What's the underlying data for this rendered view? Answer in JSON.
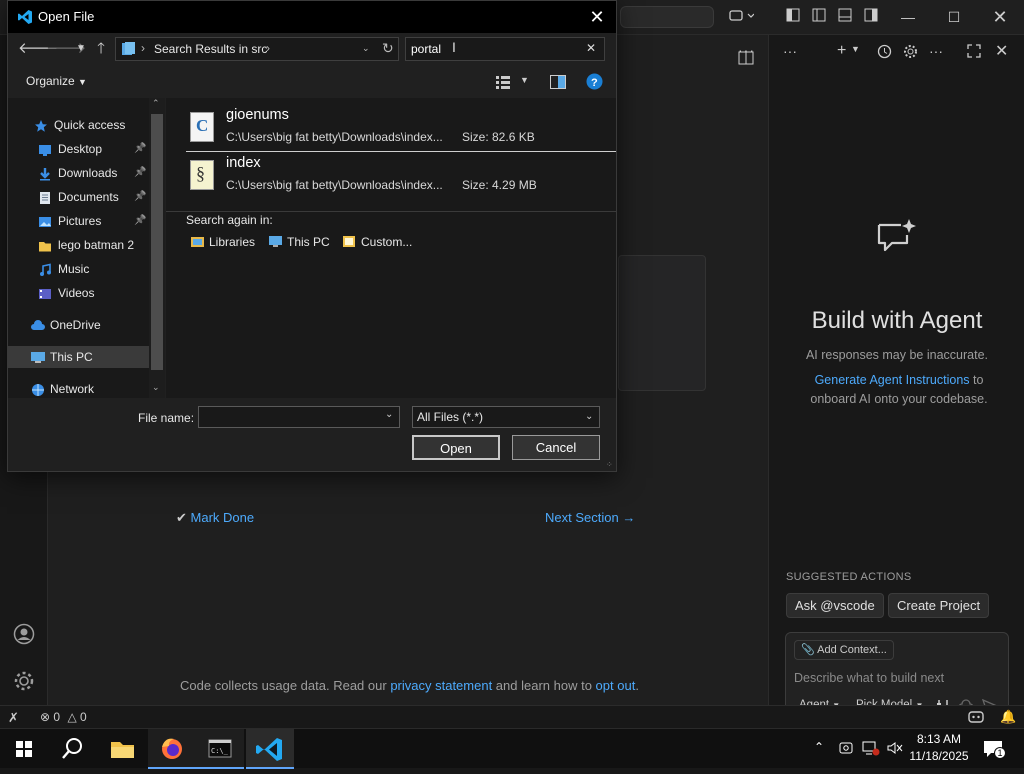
{
  "dialog": {
    "title": "Open File",
    "address": {
      "location": "Search Results in src"
    },
    "search": {
      "value": "portal"
    },
    "toolbar": {
      "organize_label": "Organize"
    },
    "nav": [
      {
        "label": "Quick access",
        "icon": "star-icon",
        "pinned": false
      },
      {
        "label": "Desktop",
        "icon": "desktop-folder-icon",
        "pinned": true
      },
      {
        "label": "Downloads",
        "icon": "download-arrow-icon",
        "pinned": true
      },
      {
        "label": "Documents",
        "icon": "documents-icon",
        "pinned": true
      },
      {
        "label": "Pictures",
        "icon": "pictures-icon",
        "pinned": true
      },
      {
        "label": "lego batman 2",
        "icon": "folder-icon",
        "pinned": false
      },
      {
        "label": "Music",
        "icon": "music-icon",
        "pinned": false
      },
      {
        "label": "Videos",
        "icon": "videos-icon",
        "pinned": false
      },
      {
        "label": "OneDrive",
        "icon": "cloud-icon",
        "pinned": false
      },
      {
        "label": "This PC",
        "icon": "computer-icon",
        "pinned": false
      },
      {
        "label": "Network",
        "icon": "network-icon",
        "pinned": false
      }
    ],
    "results": [
      {
        "name": "gioenums",
        "path": "C:\\Users\\big fat betty\\Downloads\\index...",
        "size": "Size: 82.6 KB",
        "icon": "c-source-file-icon"
      },
      {
        "name": "index",
        "path": "C:\\Users\\big fat betty\\Downloads\\index...",
        "size": "Size: 4.29 MB",
        "icon": "script-file-icon"
      }
    ],
    "search_again": {
      "label": "Search again in:",
      "items": [
        "Libraries",
        "This PC",
        "Custom..."
      ]
    },
    "file_name_label": "File name:",
    "file_name_value": "",
    "file_type": "All Files (*.*)",
    "open_label": "Open",
    "cancel_label": "Cancel"
  },
  "editor": {
    "mark_done": "Mark Done",
    "next_section": "Next Section",
    "footer_prefix": "Code collects usage data. Read our ",
    "footer_link1": "privacy statement",
    "footer_middle": " and learn how to ",
    "footer_link2": "opt out",
    "footer_suffix": "."
  },
  "agent_panel": {
    "title": "Build with Agent",
    "warning": "AI responses may be inaccurate.",
    "desc_link": "Generate Agent Instructions",
    "desc_rest": " to onboard AI onto your codebase.",
    "suggested_label": "SUGGESTED ACTIONS",
    "actions": [
      "Ask @vscode",
      "Create Project"
    ],
    "add_context": "Add Context...",
    "input_placeholder": "Describe what to build next",
    "mode": "Agent",
    "model": "Pick Model"
  },
  "statusbar": {
    "errors": "0",
    "warnings": "0"
  },
  "taskbar": {
    "time": "8:13 AM",
    "date": "11/18/2025",
    "notifications": "1"
  },
  "colors": {
    "accent": "#4daafc",
    "taskbar_active": "#60a5fa",
    "vscode_blue": "#23a9f2"
  }
}
